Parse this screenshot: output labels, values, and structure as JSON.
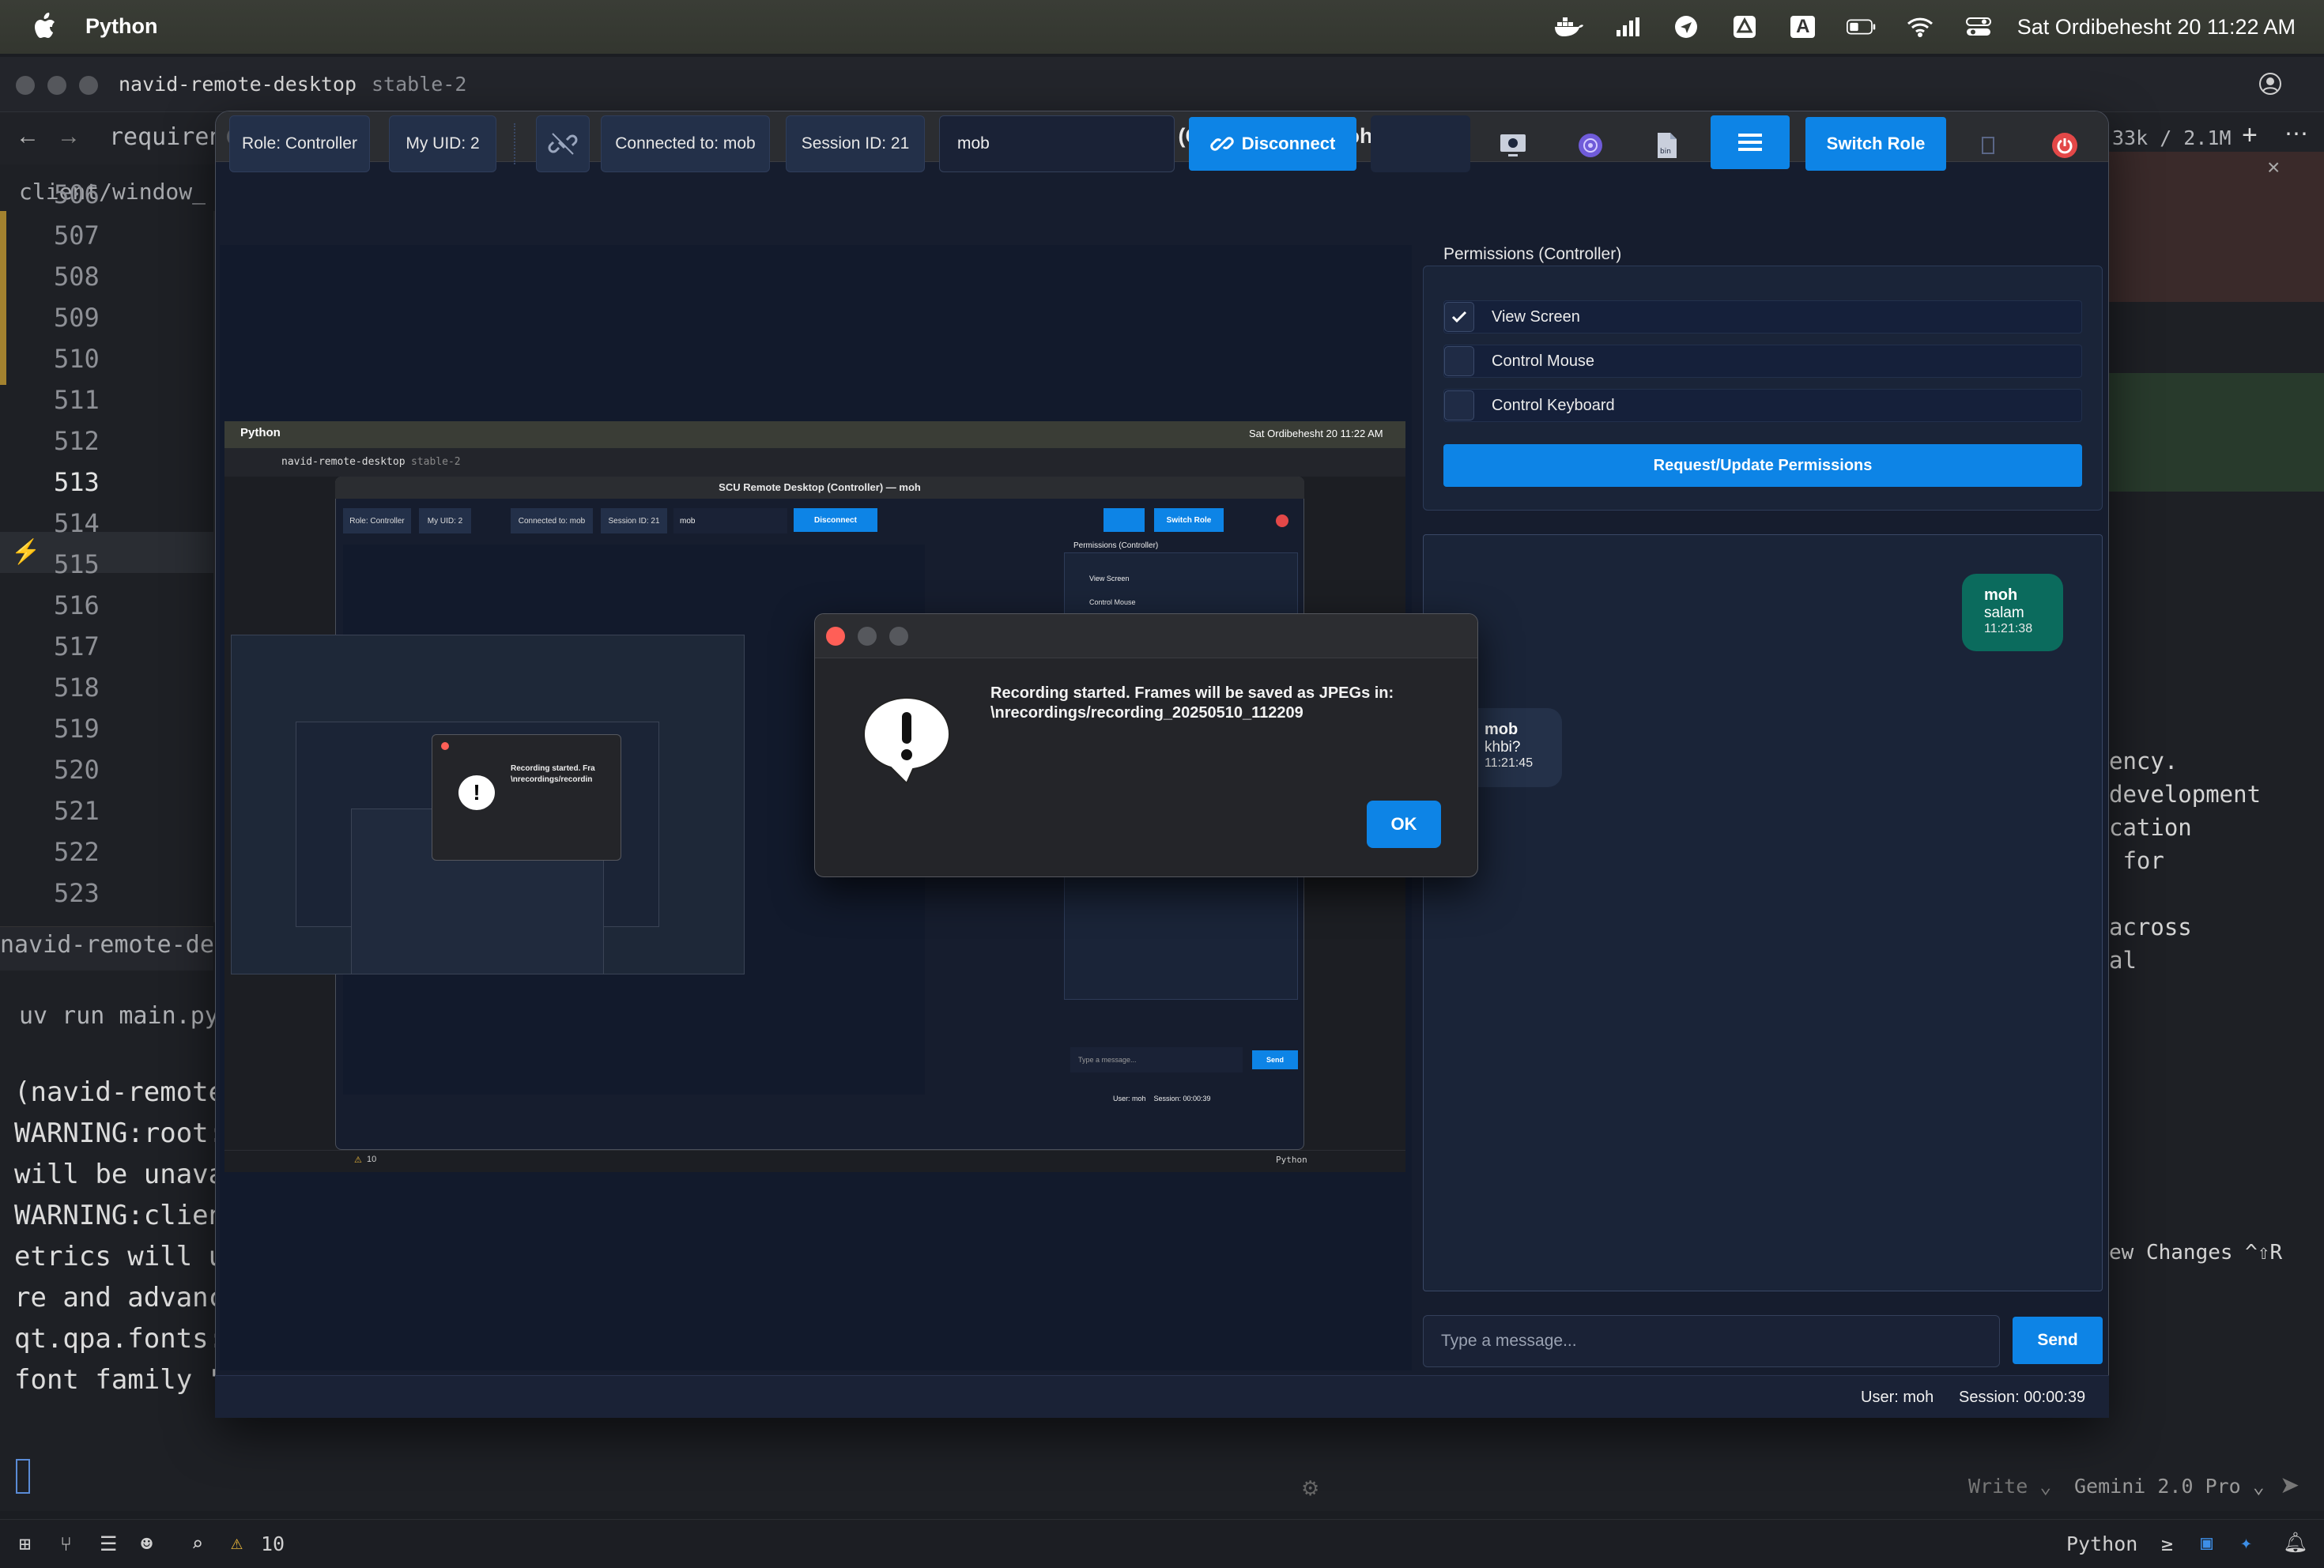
{
  "menubar": {
    "app_name": "Python",
    "clock": "Sat Ordibehesht 20  11:22 AM",
    "input_source_a": "A"
  },
  "editor": {
    "window_title": "navid-remote-desktop",
    "branch": "stable-2",
    "tab_label": "requiren",
    "tab_right_meta": "33k / 2.1M",
    "file_path": "client/window_",
    "line_numbers": [
      "506",
      "507",
      "508",
      "509",
      "510",
      "511",
      "512",
      "513",
      "514",
      "515",
      "516",
      "517",
      "518",
      "519",
      "520",
      "521",
      "522",
      "523"
    ],
    "active_line": "513",
    "terminal_tab": "navid-remote-des",
    "terminal_cmd": "uv run main.py",
    "terminal_lines": [
      "(navid-remote",
      "WARNING:root:",
      "will be unava",
      "WARNING:clien",
      "etrics will u",
      "re and advanc",
      "qt.qpa.fonts:",
      "font family \""
    ],
    "right_code_lines": [
      "ency.",
      "development",
      "cation",
      " for",
      "",
      "across",
      "al"
    ],
    "review_changes": "ew Changes ^⇧R",
    "write_mode": "Write ⌄",
    "model": "Gemini 2.0 Pro ⌄",
    "status_warnings": "10",
    "status_lang": "Python"
  },
  "remote_desktop": {
    "window_title": "SCU Remote Desktop (Controller) — moh",
    "role_label": "Role: Controller",
    "uid_label": "My UID: 2",
    "connected_label": "Connected to: mob",
    "session_label": "Session ID: 21",
    "peer_input_value": "mob",
    "disconnect_label": "Disconnect",
    "switch_role_label": "Switch Role",
    "permissions": {
      "title": "Permissions (Controller)",
      "items": [
        {
          "label": "View Screen",
          "checked": true
        },
        {
          "label": "Control Mouse",
          "checked": false
        },
        {
          "label": "Control Keyboard",
          "checked": false
        }
      ],
      "request_button": "Request/Update Permissions"
    },
    "chat": {
      "messages": [
        {
          "sender": "moh",
          "text": "salam",
          "time": "11:21:38",
          "own": true
        },
        {
          "sender": "mob",
          "text": "khbi?",
          "time": "11:21:45",
          "own": false
        }
      ],
      "input_placeholder": "Type a message...",
      "send_label": "Send"
    },
    "status": {
      "user": "User: moh",
      "session_time": "Session: 00:00:39"
    }
  },
  "alert": {
    "message": "Recording started. Frames will be saved as JPEGs in:\n\\nrecordings/recording_20250510_112209",
    "ok_label": "OK"
  },
  "nested_view": {
    "title": "SCU Remote Desktop (Controller) — moh",
    "role_label": "Role: Controller",
    "uid_label": "My UID: 2",
    "connected_label": "Connected to: mob",
    "session_label": "Session ID: 21",
    "peer": "mob",
    "disconnect_label": "Disconnect",
    "switch_role_label": "Switch Role",
    "perm_title": "Permissions (Controller)",
    "perm_view": "View Screen",
    "perm_mouse": "Control Mouse",
    "clock": "Sat Ordibehesht 20  11:22 AM",
    "app": "Python",
    "editor_title": "navid-remote-desktop",
    "branch": "stable-2",
    "alert_text": "Recording started. Fra",
    "alert_path": "\\nrecordings/recordin",
    "input_placeholder": "Type a message...",
    "send": "Send",
    "status": "User: moh    Session: 00:00:39",
    "warnings": "10",
    "lang": "Python"
  },
  "colors": {
    "accent_blue": "#0d84e6",
    "own_bubble": "#0b6b5d",
    "window_bg": "#161d2e",
    "close_red": "#ff5f57"
  }
}
